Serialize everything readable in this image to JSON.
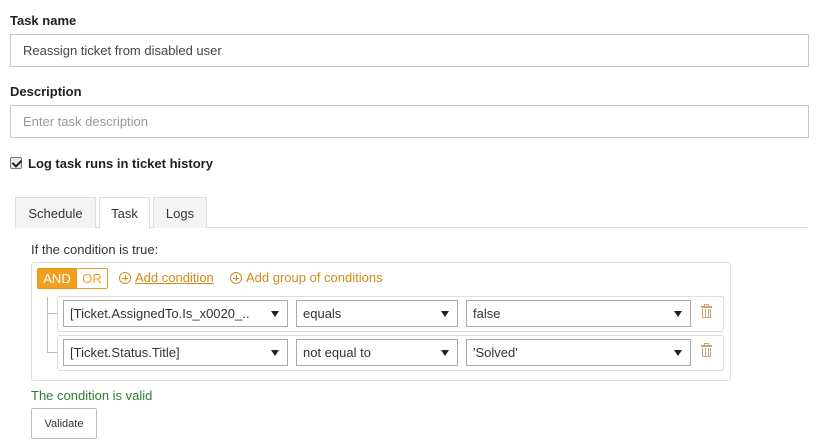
{
  "task_name": {
    "label": "Task name",
    "value": "Reassign ticket from disabled user"
  },
  "description": {
    "label": "Description",
    "placeholder": "Enter task description",
    "value": ""
  },
  "log_history": {
    "label": "Log task runs in ticket history",
    "checked": true
  },
  "tabs": [
    {
      "label": "Schedule",
      "active": false
    },
    {
      "label": "Task",
      "active": true
    },
    {
      "label": "Logs",
      "active": false
    }
  ],
  "conditions": {
    "title": "If the condition is true:",
    "and_label": "AND",
    "or_label": "OR",
    "selected_operator": "AND",
    "add_condition_label": "Add condition",
    "add_group_label": "Add group of conditions",
    "rules": [
      {
        "field": "[Ticket.AssignedTo.Is_x0020_..",
        "operator": "equals",
        "value": "false"
      },
      {
        "field": "[Ticket.Status.Title]",
        "operator": "not equal to",
        "value": "'Solved'"
      }
    ],
    "valid_message": "The condition is valid",
    "validate_label": "Validate"
  },
  "colors": {
    "accent": "#f0a020",
    "link": "#d48a17",
    "valid": "#2e7d32"
  }
}
